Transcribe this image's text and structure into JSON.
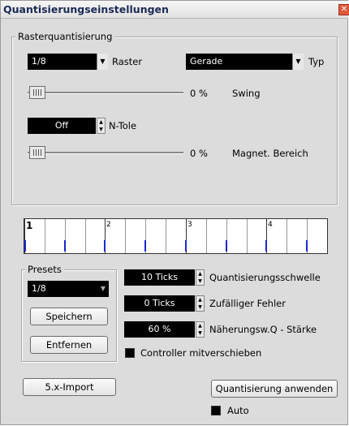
{
  "window": {
    "title": "Quantisierungseinstellungen",
    "close_glyph": "✕"
  },
  "raster_group": {
    "label": "Rasterquantisierung",
    "raster_value": "1/8",
    "raster_label": "Raster",
    "type_value": "Gerade",
    "type_label": "Typ",
    "swing_value": "0 %",
    "swing_label": "Swing",
    "swing_level": 0,
    "ntole_value": "Off",
    "ntole_label": "N-Tole",
    "magnet_value": "0 %",
    "magnet_label": "Magnet. Bereich",
    "magnet_level": 0
  },
  "grid_preview": {
    "bar_numbers": [
      "1",
      "2",
      "3",
      "4"
    ],
    "accent_color": "#1a2ad0"
  },
  "presets": {
    "label": "Presets",
    "selected": "1/8",
    "save_label": "Speichern",
    "remove_label": "Entfernen"
  },
  "params": {
    "threshold_value": "10 Ticks",
    "threshold_label": "Quantisierungsschwelle",
    "random_value": "0 Ticks",
    "random_label": "Zufälliger Fehler",
    "strength_value": "60 %",
    "strength_label": "Näherungsw.Q - Stärke",
    "controller_label": "Controller mitverschieben"
  },
  "footer": {
    "import_label": "5.x-Import",
    "apply_label": "Quantisierung anwenden",
    "auto_label": "Auto"
  }
}
